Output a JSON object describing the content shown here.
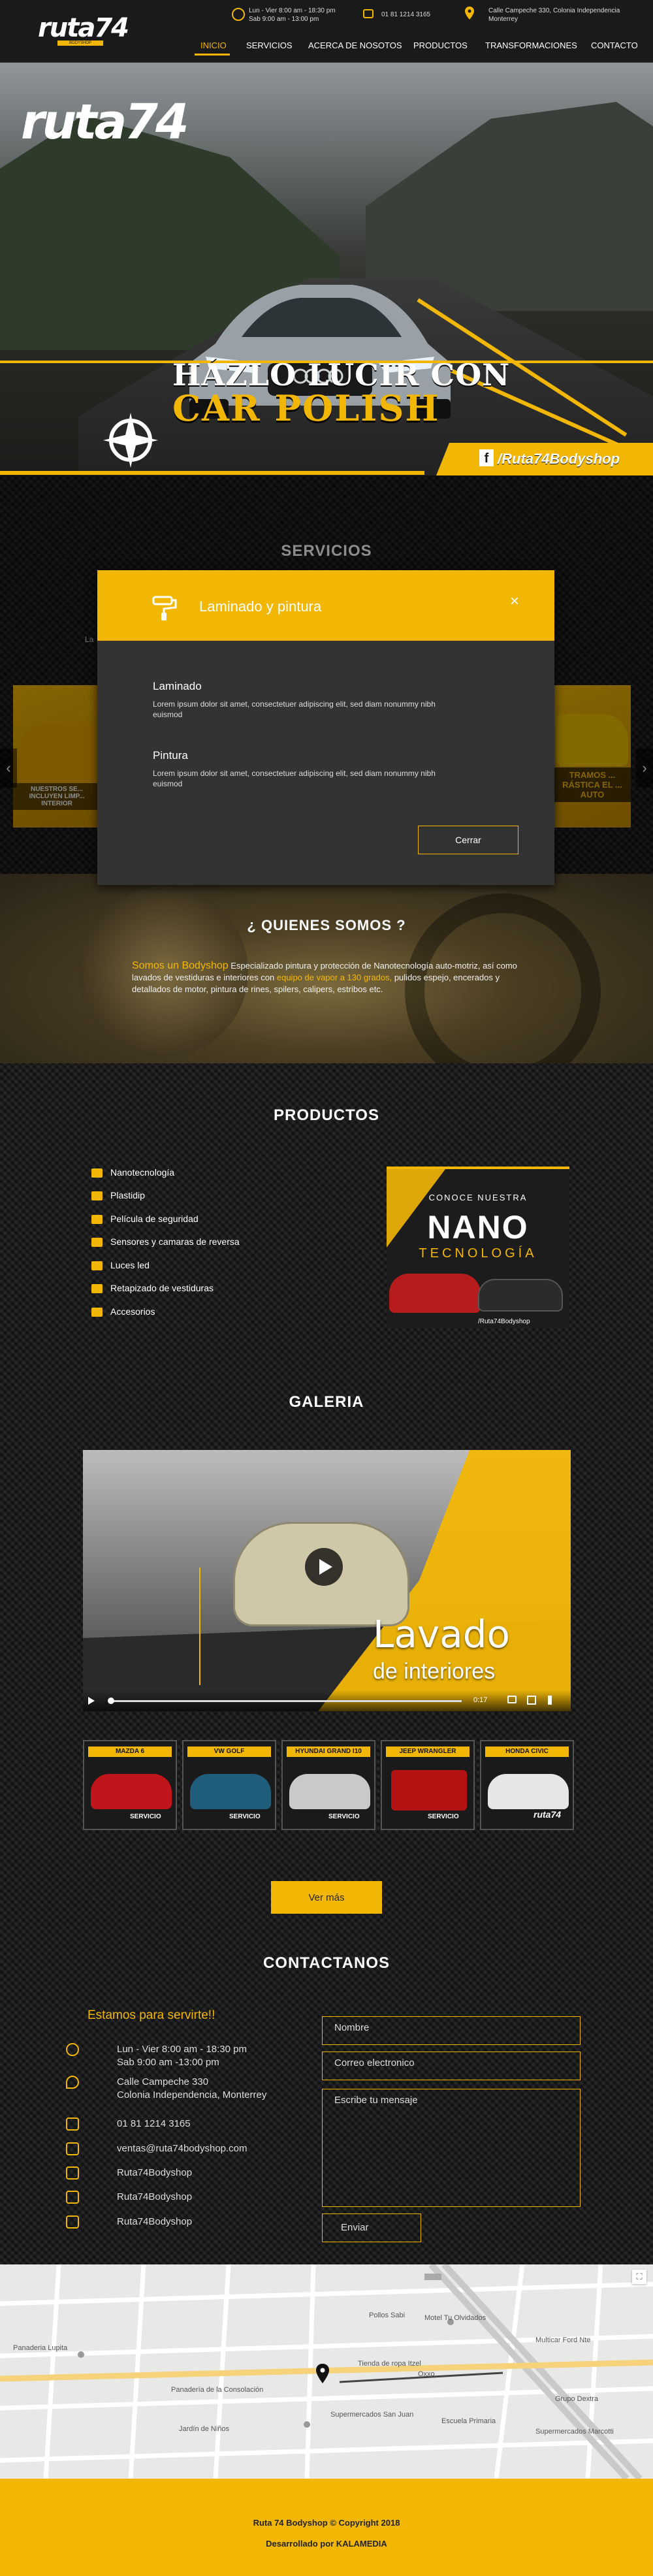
{
  "header": {
    "logo_text": "ruta74",
    "logo_sub": "BODYSHOP",
    "hours_line1": "Lun - Vier 8:00 am - 18:30 pm",
    "hours_line2": "Sab 9:00 am - 13:00 pm",
    "phone": "01 81 1214 3165",
    "address_line1": "Calle Campeche 330, Colonia Independencia",
    "address_line2": "Monterrey",
    "nav": [
      "INICIO",
      "SERVICIOS",
      "ACERCA DE NOSOTOS",
      "PRODUCTOS",
      "TRANSFORMACIONES",
      "CONTACTO"
    ]
  },
  "hero": {
    "logo_text": "ruta74",
    "title_line1": "HÁZLO LUCIR CON",
    "title_line2": "CAR POLISH",
    "social_label": "/Ruta74Bodyshop"
  },
  "servicios": {
    "title": "SERVICIOS",
    "partial_label": "La",
    "slide_left_caption": "NUESTROS SE... INCLUYEN LIMP... INTERIOR",
    "slide_right_caption": "TRAMOS ... RÁSTICA EL ... AUTO"
  },
  "modal": {
    "title": "Laminado y pintura",
    "items": [
      {
        "title": "Laminado",
        "text": "Lorem ipsum dolor sit amet, consectetuer adipiscing elit, sed diam nonummy nibh euismod"
      },
      {
        "title": "Pintura",
        "text": "Lorem ipsum dolor sit amet, consectetuer adipiscing elit, sed diam nonummy nibh euismod"
      }
    ],
    "close_label": "Cerrar"
  },
  "quienes": {
    "title": "¿ QUIENES SOMOS ?",
    "highlight1": "Somos un Bodyshop",
    "text1": " Especializado pintura y protección de Nanotecnología auto-motriz, así como lavados de vestiduras e interiores con ",
    "highlight2": "equipo de vapor a 130 grados,",
    "text2": " pulidos espejo, encerados y detallados de motor, pintura de rines, spilers, calipers, estribos etc."
  },
  "productos": {
    "title": "PRODUCTOS",
    "items": [
      "Nanotecnología",
      "Plastidip",
      "Película de seguridad",
      "Sensores y camaras de reversa",
      "Luces led",
      "Retapizado de vestiduras",
      "Accesorios"
    ],
    "promo_top": "CONOCE NUESTRA",
    "promo_word1": "NANO",
    "promo_word2": "TECNOLOGÍA",
    "promo_social": "/Ruta74Bodyshop"
  },
  "galeria": {
    "title": "GALERIA",
    "video_word1": "Lavado",
    "video_word2": "de interiores",
    "video_time": "0:17",
    "thumbs": [
      {
        "label": "MAZDA 6",
        "tag": "SERVICIO",
        "color": "#c0151b"
      },
      {
        "label": "VW GOLF",
        "tag": "SERVICIO",
        "color": "#1f5d7a"
      },
      {
        "label": "HYUNDAI GRAND I10",
        "tag": "SERVICIO",
        "color": "#c9c9c9"
      },
      {
        "label": "JEEP WRANGLER",
        "tag": "SERVICIO",
        "color": "#b31313"
      },
      {
        "label": "HONDA CIVIC",
        "tag": "ruta74",
        "color": "#e6e6e6"
      }
    ],
    "more_label": "Ver más"
  },
  "contacto": {
    "title": "CONTACTANOS",
    "subtitle": "Estamos para servirte!!",
    "hours1": "Lun - Vier 8:00 am - 18:30 pm",
    "hours2": "Sab 9:00 am -13:00 pm",
    "address1": "Calle Campeche 330",
    "address2": "Colonia Independencia, Monterrey",
    "phone": "01 81 1214 3165",
    "email": "ventas@ruta74bodyshop.com",
    "facebook": "Ruta74Bodyshop",
    "twitter": "Ruta74Bodyshop",
    "instagram": "Ruta74Bodyshop",
    "name_placeholder": "Nombre",
    "email_placeholder": "Correo electronico",
    "message_placeholder": "Escribe tu mensaje",
    "send_label": "Enviar"
  },
  "map": {
    "labels": [
      "Panaderia Lupita",
      "Tienda de ropa Itzel",
      "Pollos Sabi",
      "Motel Tu Olvidados",
      "Multicar Ford Nte",
      "Grupo Dextra",
      "Supermercados San Juan",
      "Oxxo",
      "Panadería de la Consolación",
      "Jardín de Niños",
      "Escuela Primaria",
      "Supermercados Marcotti"
    ]
  },
  "footer": {
    "copyright": "Ruta 74 Bodyshop  © Copyright 2018",
    "developed": "Desarrollado por KALAMEDIA"
  }
}
